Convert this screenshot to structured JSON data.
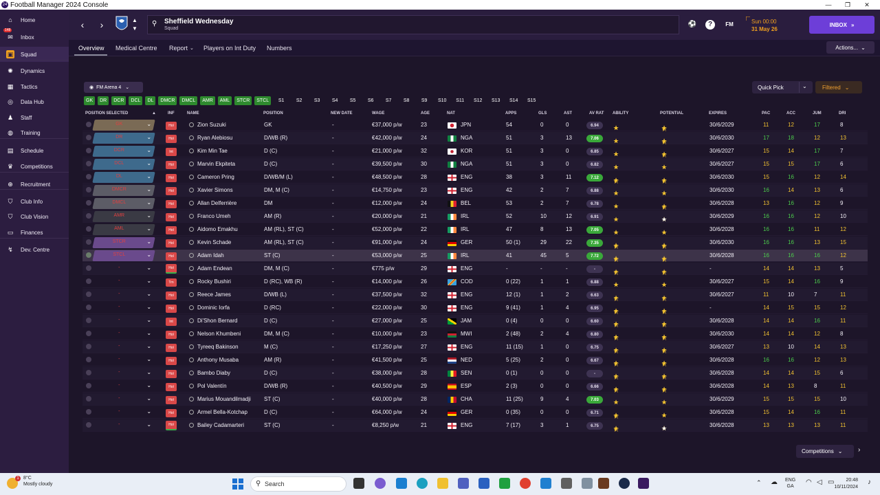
{
  "window": {
    "title": "Football Manager 2024 Console",
    "app_icon": "24"
  },
  "sidebar": {
    "items": [
      {
        "label": "Home",
        "icon": "home-icon",
        "glyph": "⌂"
      },
      {
        "label": "Inbox",
        "icon": "inbox-icon",
        "glyph": "✉",
        "badge": "148"
      },
      {
        "label": "Squad",
        "icon": "shirt-icon",
        "glyph": "▣",
        "active": true
      },
      {
        "label": "Dynamics",
        "icon": "dynamics-icon",
        "glyph": "✺"
      },
      {
        "label": "Tactics",
        "icon": "tactics-icon",
        "glyph": "▦"
      },
      {
        "label": "Data Hub",
        "icon": "data-hub-icon",
        "glyph": "◎"
      },
      {
        "label": "Staff",
        "icon": "staff-icon",
        "glyph": "♟"
      },
      {
        "label": "Training",
        "icon": "training-icon",
        "glyph": "◍"
      },
      {
        "label": "Schedule",
        "icon": "calendar-icon",
        "glyph": "▤"
      },
      {
        "label": "Competitions",
        "icon": "trophy-icon",
        "glyph": "♛"
      },
      {
        "label": "Recruitment",
        "icon": "recruitment-icon",
        "glyph": "⊕"
      },
      {
        "label": "Club Info",
        "icon": "club-info-icon",
        "glyph": "⛉"
      },
      {
        "label": "Club Vision",
        "icon": "club-vision-icon",
        "glyph": "⛉"
      },
      {
        "label": "Finances",
        "icon": "finances-icon",
        "glyph": "▭"
      },
      {
        "label": "Dev. Centre",
        "icon": "dev-centre-icon",
        "glyph": "↯"
      }
    ]
  },
  "header": {
    "club_name": "Sheffield Wednesday",
    "subtitle": "Squad",
    "fm_label": "FM",
    "time": "Sun 00:00",
    "date": "31 May 26",
    "inbox_label": "INBOX"
  },
  "tabs": {
    "items": [
      "Overview",
      "Medical Centre",
      "Report",
      "Players on Int Duty",
      "Numbers"
    ],
    "actions_label": "Actions..."
  },
  "controls": {
    "tactic_label": "FM Arena 4",
    "quick_pick_label": "Quick Pick",
    "filtered_label": "Filtered"
  },
  "formation": {
    "positions_on": [
      "GK",
      "DR",
      "DCR",
      "DCL",
      "DL",
      "DMCR",
      "DMCL",
      "AMR",
      "AML",
      "STCR",
      "STCL"
    ],
    "subs": [
      "S1",
      "S2",
      "S3",
      "S4",
      "S5",
      "S6",
      "S7",
      "S8",
      "S9",
      "S10",
      "S11",
      "S12",
      "S13",
      "S14",
      "S15"
    ]
  },
  "columns": {
    "position_selected": "POSITION SELECTED",
    "inf": "INF",
    "name": "NAME",
    "position": "POSITION",
    "new_date": "NEW DATE",
    "wage": "WAGE",
    "age": "AGE",
    "nat": "NAT",
    "apps": "APPS",
    "gls": "GLS",
    "ast": "AST",
    "av_rat": "AV RAT",
    "ability": "ABILITY",
    "potential": "POTENTIAL",
    "expires": "EXPIRES",
    "pac": "PAC",
    "acc": "ACC",
    "jum": "JUM",
    "dri": "DRI"
  },
  "players": [
    {
      "sel": "GK",
      "selc": "#7a6a55",
      "inf": "Hol",
      "name": "Zion Suzuki",
      "pos": "GK",
      "nd": "-",
      "wage": "€37,000 p/w",
      "age": "23",
      "nat": "JPN",
      "flag": "jp",
      "apps": "54",
      "gls": "0",
      "ast": "0",
      "rat": "6.94",
      "rhi": false,
      "ab": 4,
      "abh": 0,
      "po": 4,
      "poh": 1,
      "exp": "30/6/2029",
      "pac": "11",
      "pacc": "y",
      "acc": "12",
      "accc": "y",
      "jum": "17",
      "jumc": "g",
      "dri": "8",
      "dric": "w"
    },
    {
      "sel": "DR",
      "selc": "#3e6a8c",
      "inf": "Hol",
      "name": "Ryan Alebiosu",
      "pos": "D/WB (R)",
      "nd": "-",
      "wage": "€42,000 p/w",
      "age": "24",
      "nat": "NGA",
      "flag": "ng",
      "apps": "51",
      "gls": "3",
      "ast": "13",
      "rat": "7.06",
      "rhi": true,
      "ab": 3,
      "abh": 0,
      "po": 4,
      "poh": 1,
      "exp": "30/6/2030",
      "pac": "17",
      "pacc": "g",
      "acc": "18",
      "accc": "g",
      "jum": "12",
      "jumc": "y",
      "dri": "13",
      "dric": "y"
    },
    {
      "sel": "DCR",
      "selc": "#3e6a8c",
      "inf": "Int",
      "name": "Kim Min Tae",
      "pos": "D (C)",
      "nd": "-",
      "wage": "€21,000 p/w",
      "age": "32",
      "nat": "KOR",
      "flag": "kr",
      "apps": "51",
      "gls": "3",
      "ast": "0",
      "rat": "6.85",
      "rhi": false,
      "ab": 3,
      "abh": 0,
      "po": 2,
      "poh": 1,
      "exp": "30/6/2027",
      "pac": "15",
      "pacc": "y",
      "acc": "14",
      "accc": "y",
      "jum": "17",
      "jumc": "g",
      "dri": "7",
      "dric": "w"
    },
    {
      "sel": "DCL",
      "selc": "#3e6a8c",
      "inf": "Hol",
      "name": "Marvin Ekpiteta",
      "pos": "D (C)",
      "nd": "-",
      "wage": "€39,500 p/w",
      "age": "30",
      "nat": "NGA",
      "flag": "ng",
      "apps": "51",
      "gls": "3",
      "ast": "0",
      "rat": "6.82",
      "rhi": false,
      "ab": 3,
      "abh": 0,
      "po": 3,
      "poh": 0,
      "exp": "30/6/2027",
      "pac": "15",
      "pacc": "y",
      "acc": "15",
      "accc": "y",
      "jum": "17",
      "jumc": "g",
      "dri": "6",
      "dric": "w"
    },
    {
      "sel": "DL",
      "selc": "#3e6a8c",
      "inf": "Hol",
      "name": "Cameron Pring",
      "pos": "D/WB/M (L)",
      "nd": "-",
      "wage": "€48,500 p/w",
      "age": "28",
      "nat": "ENG",
      "flag": "en",
      "apps": "38",
      "gls": "3",
      "ast": "11",
      "rat": "7.12",
      "rhi": true,
      "ab": 3,
      "abh": 1,
      "po": 3,
      "poh": 1,
      "exp": "30/6/2030",
      "pac": "15",
      "pacc": "y",
      "acc": "16",
      "accc": "g",
      "jum": "12",
      "jumc": "y",
      "dri": "14",
      "dric": "y"
    },
    {
      "sel": "DMCR",
      "selc": "#5c5c66",
      "inf": "Hol",
      "name": "Xavier Simons",
      "pos": "DM, M (C)",
      "nd": "-",
      "wage": "€14,750 p/w",
      "age": "23",
      "nat": "ENG",
      "flag": "en",
      "apps": "42",
      "gls": "2",
      "ast": "7",
      "rat": "6.88",
      "rhi": false,
      "ab": 3,
      "abh": 0,
      "po": 4,
      "poh": 0,
      "exp": "30/6/2030",
      "pac": "16",
      "pacc": "g",
      "acc": "14",
      "accc": "y",
      "jum": "13",
      "jumc": "y",
      "dri": "6",
      "dric": "w"
    },
    {
      "sel": "DMCL",
      "selc": "#5c5c66",
      "inf": "Hol",
      "name": "Allan Delferrière",
      "pos": "DM",
      "nd": "-",
      "wage": "€12,000 p/w",
      "age": "24",
      "nat": "BEL",
      "flag": "be",
      "apps": "53",
      "gls": "2",
      "ast": "7",
      "rat": "6.78",
      "rhi": false,
      "ab": 2,
      "abh": 0,
      "po": 2,
      "poh": 1,
      "exp": "30/6/2028",
      "pac": "13",
      "pacc": "y",
      "acc": "16",
      "accc": "g",
      "jum": "12",
      "jumc": "y",
      "dri": "9",
      "dric": "w"
    },
    {
      "sel": "AMR",
      "selc": "#3a3a44",
      "inf": "Hol",
      "name": "Franco Umeh",
      "pos": "AM (R)",
      "nd": "-",
      "wage": "€20,000 p/w",
      "age": "21",
      "nat": "IRL",
      "flag": "ie",
      "apps": "52",
      "gls": "10",
      "ast": "12",
      "rat": "6.91",
      "rhi": false,
      "ab": 2,
      "abh": 0,
      "po": 2,
      "poh": 0,
      "pow": 1,
      "exp": "30/6/2029",
      "pac": "16",
      "pacc": "g",
      "acc": "16",
      "accc": "g",
      "jum": "12",
      "jumc": "y",
      "dri": "10",
      "dric": "w"
    },
    {
      "sel": "AML",
      "selc": "#3a3a44",
      "inf": "Hol",
      "name": "Aidomo Emakhu",
      "pos": "AM (RL), ST (C)",
      "nd": "-",
      "wage": "€52,000 p/w",
      "age": "22",
      "nat": "IRL",
      "flag": "ie",
      "apps": "47",
      "gls": "8",
      "ast": "13",
      "rat": "7.05",
      "rhi": true,
      "ab": 3,
      "abh": 0,
      "po": 4,
      "poh": 0,
      "exp": "30/6/2028",
      "pac": "16",
      "pacc": "g",
      "acc": "16",
      "accc": "g",
      "jum": "11",
      "jumc": "y",
      "dri": "12",
      "dric": "y"
    },
    {
      "sel": "STCR",
      "selc": "#6a4a8c",
      "inf": "Hol",
      "name": "Kevin Schade",
      "pos": "AM (RL), ST (C)",
      "nd": "-",
      "wage": "€91,000 p/w",
      "age": "24",
      "nat": "GER",
      "flag": "de",
      "apps": "50 (1)",
      "gls": "29",
      "ast": "22",
      "rat": "7.35",
      "rhi": true,
      "ab": 4,
      "abh": 1,
      "po": 4,
      "poh": 1,
      "exp": "30/6/2030",
      "pac": "16",
      "pacc": "g",
      "acc": "16",
      "accc": "g",
      "jum": "13",
      "jumc": "y",
      "dri": "15",
      "dric": "y"
    },
    {
      "sel": "STCL",
      "selc": "#6a4a8c",
      "inf": "Hol",
      "name": "Adam Idah",
      "pos": "ST (C)",
      "nd": "-",
      "wage": "€53,000 p/w",
      "age": "25",
      "nat": "IRL",
      "flag": "ie",
      "apps": "41",
      "gls": "45",
      "ast": "5",
      "rat": "7.72",
      "rhi": true,
      "ab": 4,
      "abh": 1,
      "po": 4,
      "poh": 1,
      "exp": "30/6/2028",
      "pac": "16",
      "pacc": "g",
      "acc": "16",
      "accc": "g",
      "jum": "16",
      "jumc": "g",
      "dri": "12",
      "dric": "y"
    },
    {
      "sel": "-",
      "selc": "",
      "inf": "Hol",
      "tall": true,
      "name": "Adam Endean",
      "pos": "DM, M (C)",
      "nd": "-",
      "wage": "€775 p/w",
      "age": "29",
      "nat": "ENG",
      "flag": "en",
      "apps": "-",
      "gls": "-",
      "ast": "-",
      "rat": "-",
      "rhi": false,
      "ab": 1,
      "abh": 1,
      "po": 1,
      "poh": 1,
      "exp": "-",
      "pac": "14",
      "pacc": "y",
      "acc": "14",
      "accc": "y",
      "jum": "13",
      "jumc": "y",
      "dri": "5",
      "dric": "w"
    },
    {
      "sel": "-",
      "selc": "",
      "inf": "Trn",
      "name": "Rocky Bushiri",
      "pos": "D (RC), WB (R)",
      "nd": "-",
      "wage": "€14,000 p/w",
      "age": "26",
      "nat": "COD",
      "flag": "cd",
      "apps": "0 (22)",
      "gls": "1",
      "ast": "1",
      "rat": "6.88",
      "rhi": false,
      "ab": 3,
      "abh": 0,
      "po": 3,
      "poh": 0,
      "exp": "30/6/2027",
      "pac": "15",
      "pacc": "y",
      "acc": "14",
      "accc": "y",
      "jum": "16",
      "jumc": "g",
      "dri": "9",
      "dric": "w"
    },
    {
      "sel": "-",
      "selc": "",
      "inf": "Hol",
      "name": "Reece James",
      "pos": "D/WB (L)",
      "nd": "-",
      "wage": "€37,500 p/w",
      "age": "32",
      "nat": "ENG",
      "flag": "en",
      "apps": "12 (1)",
      "gls": "1",
      "ast": "2",
      "rat": "6.63",
      "rhi": false,
      "ab": 1,
      "abh": 1,
      "po": 1,
      "poh": 1,
      "exp": "30/6/2027",
      "pac": "11",
      "pacc": "y",
      "acc": "10",
      "accc": "w",
      "jum": "7",
      "jumc": "w",
      "dri": "11",
      "dric": "y"
    },
    {
      "sel": "-",
      "selc": "",
      "inf": "Hol",
      "name": "Dominic Iorfa",
      "pos": "D (RC)",
      "nd": "-",
      "wage": "€22,000 p/w",
      "age": "30",
      "nat": "ENG",
      "flag": "en",
      "apps": "9 (41)",
      "gls": "1",
      "ast": "4",
      "rat": "6.95",
      "rhi": false,
      "ab": 2,
      "abh": 1,
      "po": 2,
      "poh": 1,
      "exp": "-",
      "pac": "14",
      "pacc": "y",
      "acc": "15",
      "accc": "y",
      "jum": "15",
      "jumc": "y",
      "dri": "12",
      "dric": "y"
    },
    {
      "sel": "-",
      "selc": "",
      "inf": "Int",
      "name": "Di'Shon Bernard",
      "pos": "D (C)",
      "nd": "-",
      "wage": "€27,000 p/w",
      "age": "25",
      "nat": "JAM",
      "flag": "jm",
      "apps": "0 (4)",
      "gls": "0",
      "ast": "0",
      "rat": "6.60",
      "rhi": false,
      "ab": 2,
      "abh": 1,
      "po": 2,
      "poh": 1,
      "exp": "30/6/2028",
      "pac": "14",
      "pacc": "y",
      "acc": "14",
      "accc": "y",
      "jum": "16",
      "jumc": "g",
      "dri": "11",
      "dric": "y"
    },
    {
      "sel": "-",
      "selc": "",
      "inf": "Hol",
      "name": "Nelson Khumbeni",
      "pos": "DM, M (C)",
      "nd": "-",
      "wage": "€10,000 p/w",
      "age": "23",
      "nat": "MWI",
      "flag": "mw",
      "apps": "2 (48)",
      "gls": "2",
      "ast": "4",
      "rat": "6.80",
      "rhi": false,
      "ab": 2,
      "abh": 1,
      "po": 3,
      "poh": 1,
      "exp": "30/6/2030",
      "pac": "14",
      "pacc": "y",
      "acc": "14",
      "accc": "y",
      "jum": "12",
      "jumc": "y",
      "dri": "8",
      "dric": "w"
    },
    {
      "sel": "-",
      "selc": "",
      "inf": "Hol",
      "name": "Tyreeq Bakinson",
      "pos": "M (C)",
      "nd": "-",
      "wage": "€17,250 p/w",
      "age": "27",
      "nat": "ENG",
      "flag": "en",
      "apps": "11 (15)",
      "gls": "1",
      "ast": "0",
      "rat": "6.75",
      "rhi": false,
      "ab": 2,
      "abh": 1,
      "po": 2,
      "poh": 1,
      "exp": "30/6/2027",
      "pac": "13",
      "pacc": "y",
      "acc": "10",
      "accc": "w",
      "jum": "14",
      "jumc": "y",
      "dri": "13",
      "dric": "y"
    },
    {
      "sel": "-",
      "selc": "",
      "inf": "Hol",
      "name": "Anthony Musaba",
      "pos": "AM (R)",
      "nd": "-",
      "wage": "€41,500 p/w",
      "age": "25",
      "nat": "NED",
      "flag": "nl",
      "apps": "5 (25)",
      "gls": "2",
      "ast": "0",
      "rat": "6.67",
      "rhi": false,
      "ab": 2,
      "abh": 1,
      "po": 2,
      "poh": 1,
      "exp": "30/6/2028",
      "pac": "16",
      "pacc": "g",
      "acc": "16",
      "accc": "g",
      "jum": "12",
      "jumc": "y",
      "dri": "13",
      "dric": "y"
    },
    {
      "sel": "-",
      "selc": "",
      "inf": "Hol",
      "name": "Bambo Diaby",
      "pos": "D (C)",
      "nd": "-",
      "wage": "€38,000 p/w",
      "age": "28",
      "nat": "SEN",
      "flag": "sn",
      "apps": "0 (1)",
      "gls": "0",
      "ast": "0",
      "rat": "-",
      "rhi": false,
      "ab": 2,
      "abh": 1,
      "po": 2,
      "poh": 1,
      "exp": "30/6/2028",
      "pac": "14",
      "pacc": "y",
      "acc": "14",
      "accc": "y",
      "jum": "15",
      "jumc": "y",
      "dri": "6",
      "dric": "w"
    },
    {
      "sel": "-",
      "selc": "",
      "inf": "Hol",
      "name": "Pol Valentín",
      "pos": "D/WB (R)",
      "nd": "-",
      "wage": "€40,500 p/w",
      "age": "29",
      "nat": "ESP",
      "flag": "es",
      "apps": "2 (3)",
      "gls": "0",
      "ast": "0",
      "rat": "6.66",
      "rhi": false,
      "ab": 2,
      "abh": 1,
      "po": 2,
      "poh": 1,
      "exp": "30/6/2028",
      "pac": "14",
      "pacc": "y",
      "acc": "13",
      "accc": "y",
      "jum": "8",
      "jumc": "w",
      "dri": "11",
      "dric": "y"
    },
    {
      "sel": "-",
      "selc": "",
      "inf": "Hol",
      "name": "Marius Mouandilmadji",
      "pos": "ST (C)",
      "nd": "-",
      "wage": "€40,000 p/w",
      "age": "28",
      "nat": "CHA",
      "flag": "td",
      "apps": "11 (25)",
      "gls": "9",
      "ast": "4",
      "rat": "7.03",
      "rhi": true,
      "ab": 3,
      "abh": 0,
      "po": 3,
      "poh": 0,
      "exp": "30/6/2029",
      "pac": "15",
      "pacc": "y",
      "acc": "15",
      "accc": "y",
      "jum": "15",
      "jumc": "y",
      "dri": "10",
      "dric": "w"
    },
    {
      "sel": "-",
      "selc": "",
      "inf": "Hol",
      "name": "Armel Bella-Kotchap",
      "pos": "D (C)",
      "nd": "-",
      "wage": "€64,000 p/w",
      "age": "24",
      "nat": "GER",
      "flag": "de",
      "apps": "0 (35)",
      "gls": "0",
      "ast": "0",
      "rat": "6.71",
      "rhi": false,
      "ab": 3,
      "abh": 1,
      "po": 4,
      "poh": 0,
      "exp": "30/6/2028",
      "pac": "15",
      "pacc": "y",
      "acc": "14",
      "accc": "y",
      "jum": "16",
      "jumc": "g",
      "dri": "11",
      "dric": "y"
    },
    {
      "sel": "-",
      "selc": "",
      "inf": "Hol",
      "tall": true,
      "name": "Bailey Cadamarteri",
      "pos": "ST (C)",
      "nd": "-",
      "wage": "€8,250 p/w",
      "age": "21",
      "nat": "ENG",
      "flag": "en",
      "apps": "7 (17)",
      "gls": "3",
      "ast": "1",
      "rat": "6.75",
      "rhi": false,
      "ab": 2,
      "abh": 1,
      "po": 4,
      "poh": 0,
      "pow": 1,
      "exp": "30/6/2028",
      "pac": "13",
      "pacc": "y",
      "acc": "13",
      "accc": "y",
      "jum": "13",
      "jumc": "y",
      "dri": "11",
      "dric": "y"
    }
  ],
  "footer": {
    "competitions_label": "Competitions"
  },
  "taskbar": {
    "temp": "8°C",
    "weather": "Mostly cloudy",
    "search_placeholder": "Search",
    "lang1": "ENG",
    "lang2": "GA",
    "time": "20:48",
    "date": "10/11/2024"
  },
  "colors": {
    "accent": "#6d3ed8",
    "orange": "#f0a020",
    "green_rating": "#3aa83a"
  }
}
